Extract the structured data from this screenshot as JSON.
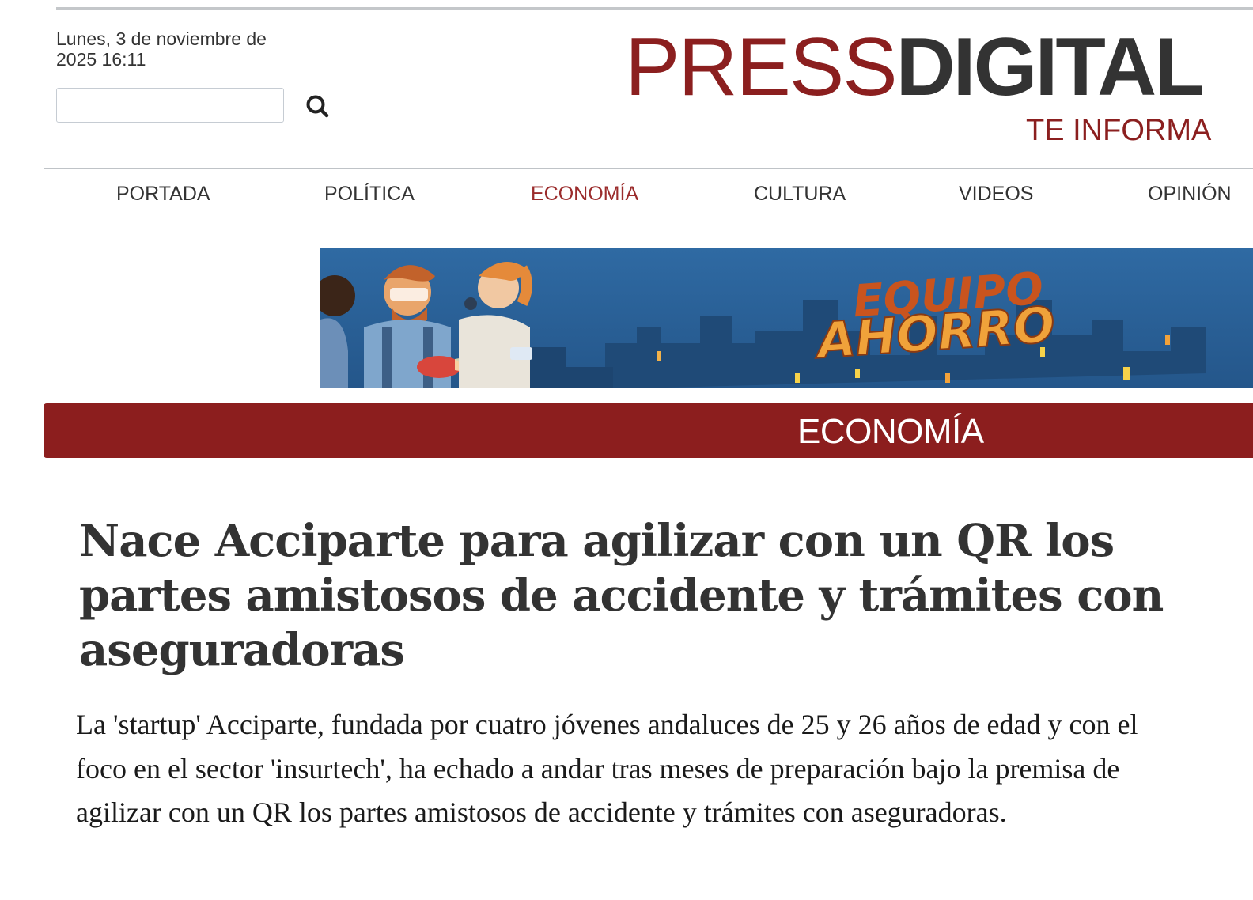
{
  "header": {
    "date": "Lunes, 3 de noviembre de 2025 16:11",
    "search": {
      "placeholder": "",
      "value": "",
      "icon": "search-icon"
    },
    "logo": {
      "part1": "PRESS",
      "part2": "DIGITAL",
      "tagline": "TE INFORMA"
    }
  },
  "nav": {
    "items": [
      {
        "label": "PORTADA"
      },
      {
        "label": "POLÍTICA"
      },
      {
        "label": "ECONOMÍA"
      },
      {
        "label": "CULTURA"
      },
      {
        "label": "VIDEOS"
      },
      {
        "label": "OPINIÓN"
      }
    ],
    "active": "ECONOMÍA"
  },
  "banner": {
    "line1": "EQUIPO",
    "line2": "AHORRO"
  },
  "section": {
    "title": "ECONOMÍA"
  },
  "article": {
    "headline": "Nace Acciparte para agilizar con un QR los partes amistosos de accidente y trámites con aseguradoras",
    "lead": "La 'startup' Acciparte, fundada por cuatro jóvenes andaluces de 25 y 26 años de edad y con el foco en el sector 'insurtech', ha echado a andar tras meses de preparación bajo la premisa de agilizar con un QR los partes amistosos de accidente y trámites con aseguradoras."
  },
  "colors": {
    "brand_red": "#8c1e1e",
    "text_dark": "#333333",
    "nav_active": "#9b2c2c",
    "banner_blue": "#2b5f94"
  }
}
